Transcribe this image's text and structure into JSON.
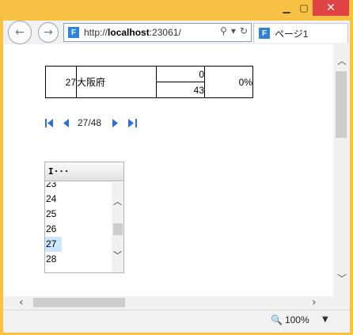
{
  "browser": {
    "url_prefix": "http://",
    "url_host": "localhost",
    "url_rest": ":23061/",
    "tab_title": "ページ1",
    "zoom": "100%"
  },
  "report": {
    "code": "27",
    "name": "大阪府",
    "value_top": "0",
    "value_bottom": "43",
    "percent": "0%"
  },
  "pager": {
    "text": "27/48"
  },
  "list": {
    "header": "I···",
    "items": [
      "23",
      "24",
      "25",
      "26",
      "27",
      "28"
    ],
    "selected": "27"
  }
}
